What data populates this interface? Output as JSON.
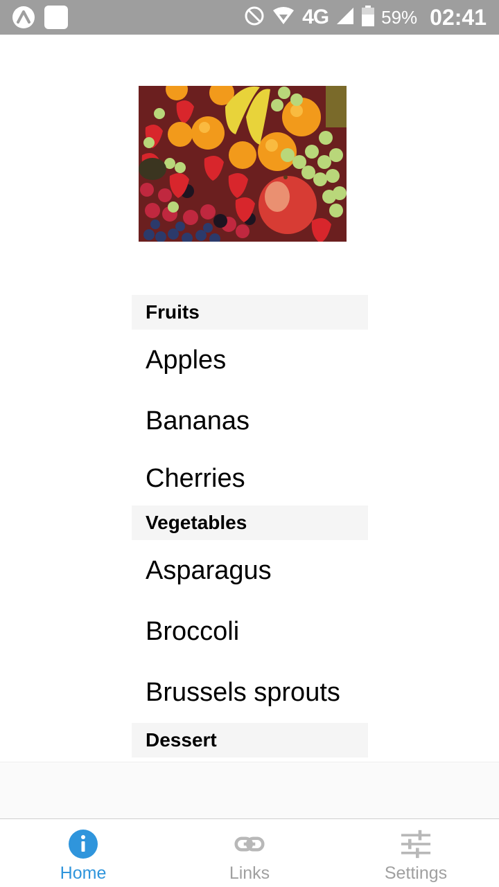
{
  "status_bar": {
    "network": "4G",
    "battery": "59%",
    "time": "02:41"
  },
  "sections": [
    {
      "title": "Fruits",
      "items": [
        "Apples",
        "Bananas",
        "Cherries"
      ]
    },
    {
      "title": "Vegetables",
      "items": [
        "Asparagus",
        "Broccoli",
        "Brussels sprouts"
      ]
    },
    {
      "title": "Dessert",
      "items": []
    }
  ],
  "tabs": [
    {
      "label": "Home",
      "icon": "info-icon",
      "active": true
    },
    {
      "label": "Links",
      "icon": "link-icon",
      "active": false
    },
    {
      "label": "Settings",
      "icon": "sliders-icon",
      "active": false
    }
  ],
  "colors": {
    "accent": "#2f95dc",
    "inactive": "#a0a0a0",
    "statusbar": "#9e9e9e",
    "section_bg": "#f5f5f5"
  }
}
